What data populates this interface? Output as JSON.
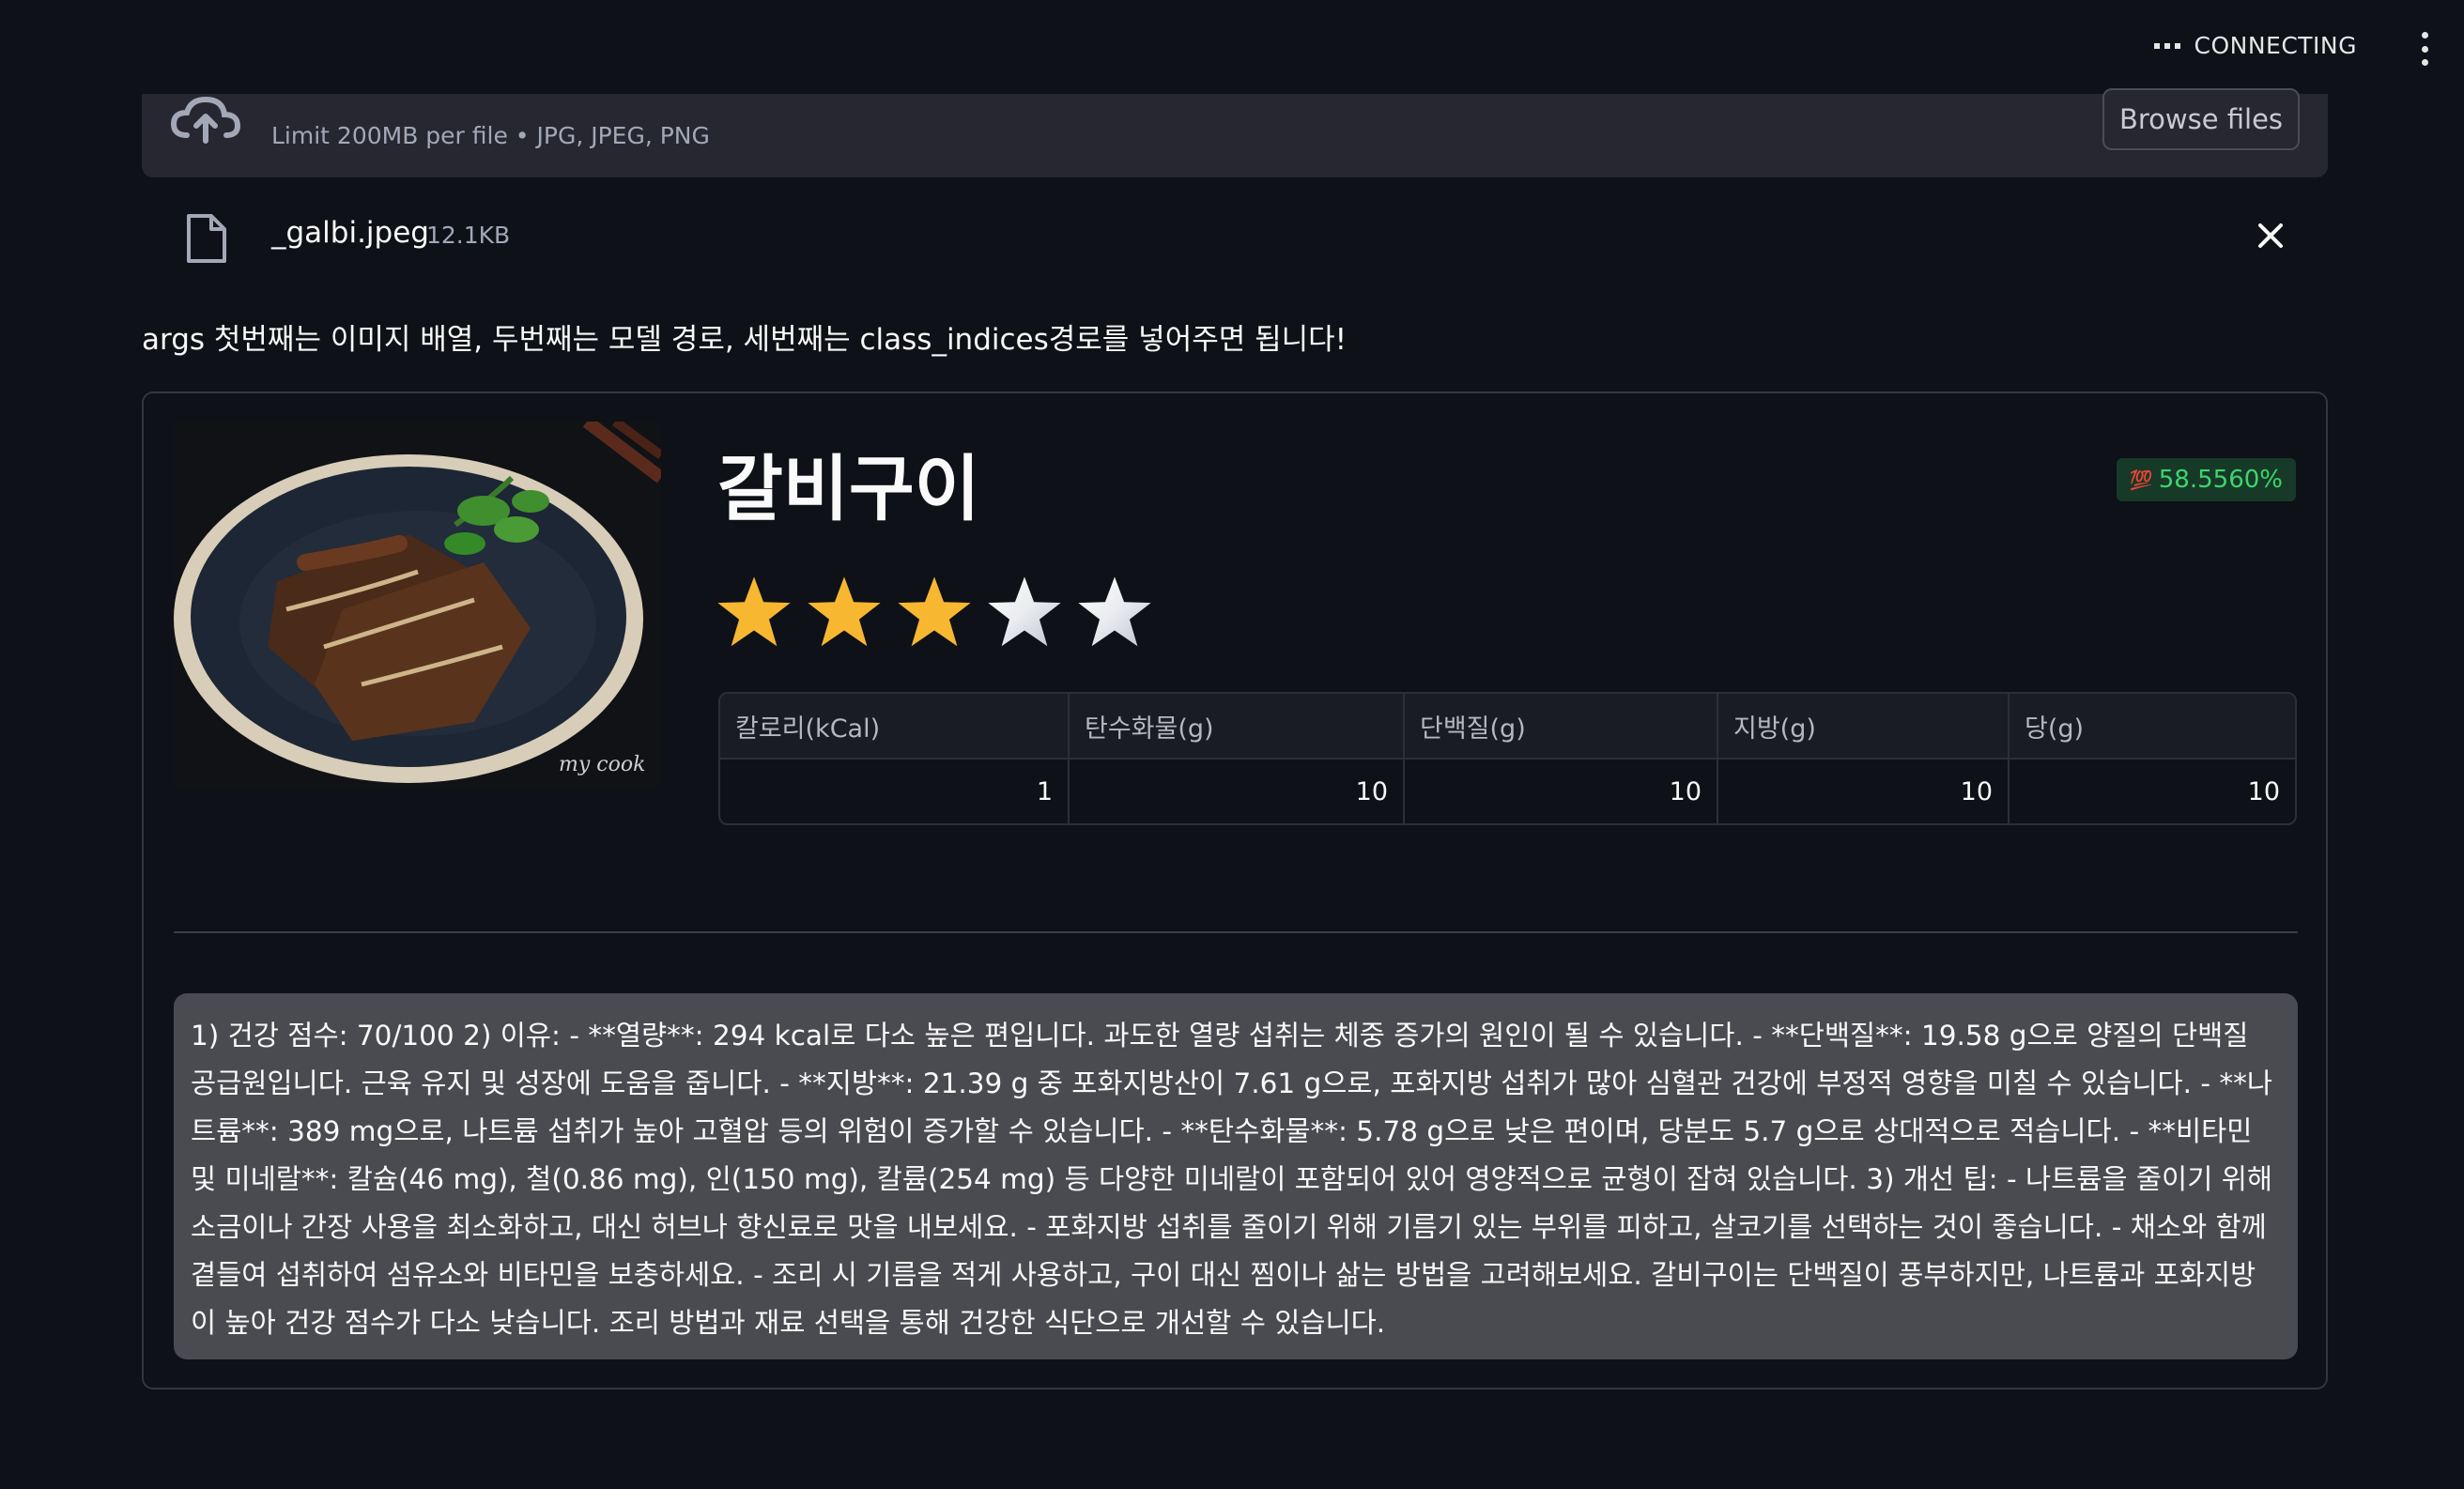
{
  "header": {
    "status": "CONNECTING"
  },
  "uploader": {
    "limit_text": "Limit 200MB per file • JPG, JPEG, PNG",
    "browse_label": "Browse files"
  },
  "file": {
    "name": "_galbi.jpeg",
    "size": "12.1KB"
  },
  "args_text": "args 첫번째는 이미지 배열, 두번째는 모델 경로, 세번째는 class_indices경로를 넣어주면 됩니다!",
  "result": {
    "title": "갈비구이",
    "confidence": "58.5560%",
    "confidence_icon": "hundred-points-icon",
    "rating": 3,
    "rating_max": 5,
    "image_watermark": "my cook",
    "nutrition": {
      "headers": [
        "칼로리(kCal)",
        "탄수화물(g)",
        "단백질(g)",
        "지방(g)",
        "당(g)"
      ],
      "values": [
        "1",
        "10",
        "10",
        "10",
        "10"
      ]
    },
    "feedback": "1) 건강 점수: 70/100 2) 이유: - **열량**: 294 kcal로 다소 높은 편입니다. 과도한 열량 섭취는 체중 증가의 원인이 될 수 있습니다. - **단백질**: 19.58 g으로 양질의 단백질 공급원입니다. 근육 유지 및 성장에 도움을 줍니다. - **지방**: 21.39 g 중 포화지방산이 7.61 g으로, 포화지방 섭취가 많아 심혈관 건강에 부정적 영향을 미칠 수 있습니다. - **나트륨**: 389 mg으로, 나트륨 섭취가 높아 고혈압 등의 위험이 증가할 수 있습니다. - **탄수화물**: 5.78 g으로 낮은 편이며, 당분도 5.7 g으로 상대적으로 적습니다. - **비타민 및 미네랄**: 칼슘(46 mg), 철(0.86 mg), 인(150 mg), 칼륨(254 mg) 등 다양한 미네랄이 포함되어 있어 영양적으로 균형이 잡혀 있습니다. 3) 개선 팁: - 나트륨을 줄이기 위해 소금이나 간장 사용을 최소화하고, 대신 허브나 향신료로 맛을 내보세요. - 포화지방 섭취를 줄이기 위해 기름기 있는 부위를 피하고, 살코기를 선택하는 것이 좋습니다. - 채소와 함께 곁들여 섭취하여 섬유소와 비타민을 보충하세요. - 조리 시 기름을 적게 사용하고, 구이 대신 찜이나 삶는 방법을 고려해보세요. 갈비구이는 단백질이 풍부하지만, 나트륨과 포화지방이 높아 건강 점수가 다소 낮습니다. 조리 방법과 재료 선택을 통해 건강한 식단으로 개선할 수 있습니다."
  },
  "colors": {
    "background": "#0e1117",
    "star_filled": "#f7b731",
    "star_empty": "#ffffff",
    "badge_text": "#3dd56d",
    "badge_bg": "#173928"
  }
}
